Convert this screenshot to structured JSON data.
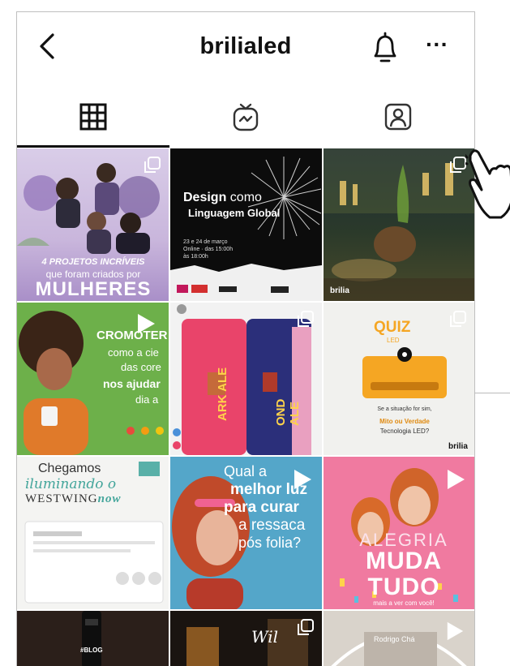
{
  "header": {
    "title": "brilialed",
    "back_icon": "chevron-left-icon",
    "bell_icon": "bell-icon",
    "more_label": "···"
  },
  "tabs": [
    {
      "name": "grid",
      "icon": "grid-icon",
      "active": true
    },
    {
      "name": "igtv",
      "icon": "igtv-icon",
      "active": false
    },
    {
      "name": "tagged",
      "icon": "tagged-user-icon",
      "active": false
    }
  ],
  "posts": {
    "p1": {
      "line1": "4 PROJETOS INCRÍVEIS",
      "line2": "que foram criados por",
      "line3": "MULHERES",
      "type": "album"
    },
    "p2": {
      "title1": "Design",
      "title2": "como",
      "title3": "Linguagem Global",
      "date": "23 e 24 de março",
      "online": "Online · das 15:00h",
      "time": "às 18:00h",
      "type": "album"
    },
    "p3": {
      "corner": "brilia",
      "type": "album"
    },
    "p4": {
      "title": "CROMOTER",
      "l1": "como a cie",
      "l2": "das core",
      "l3": "nos ajudar",
      "l4": "dia a",
      "type": "video"
    },
    "p5": {
      "sign1": "ARK ALE",
      "sign2": "OND ALE",
      "type": "album"
    },
    "p6": {
      "title": "QUIZ",
      "sub": "LED",
      "l1": "Se a situação for sim,",
      "l2": "Mito ou Verdade",
      "l3": "Tecnologia LED?",
      "brand": "brilia",
      "type": "album"
    },
    "p7": {
      "l1": "Chegamos",
      "l2": "iluminando o",
      "l3": "WESTWING",
      "l4": "now",
      "type": "none"
    },
    "p8": {
      "l1": "Qual a",
      "l2": "melhor luz",
      "l3": "para curar",
      "l4": "a ressaca",
      "l5": "pós folia?",
      "type": "video"
    },
    "p9": {
      "l1": "ALEGRIA",
      "l2": "MUDA",
      "l3": "TUDO",
      "l4": "mais a ver com você!",
      "type": "video"
    },
    "p10": {
      "tag": "#BLOG",
      "type": "none"
    },
    "p11": {
      "l1": "Wil",
      "type": "album"
    },
    "p12": {
      "l1": "Rodrigo Chá",
      "type": "video"
    }
  },
  "colors": {
    "accent": "#111111",
    "border": "#bfbfbf"
  }
}
